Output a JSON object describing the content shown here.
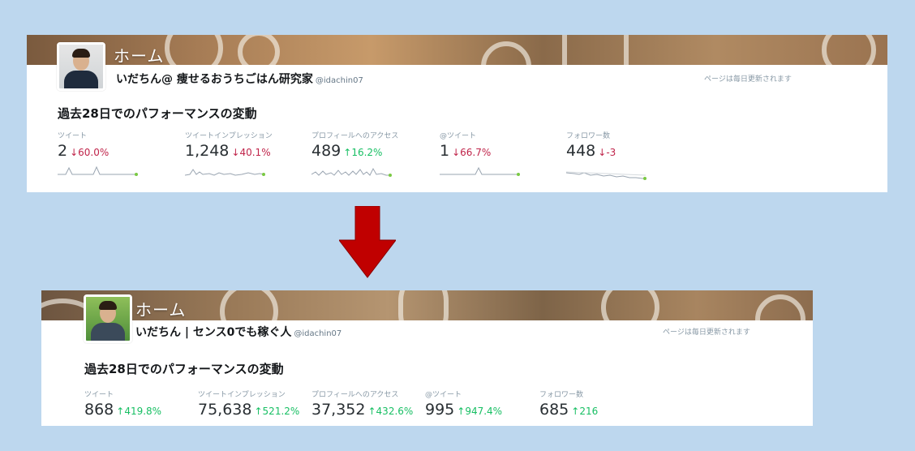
{
  "before": {
    "banner_title": "ホーム",
    "display_name": "いだちん@ 痩せるおうちごはん研究家",
    "handle": "@idachin07",
    "update_note": "ページは毎日更新されます",
    "section_title": "過去28日でのパフォーマンスの変動",
    "metrics": [
      {
        "label": "ツイート",
        "value": "2",
        "arrow": "↓",
        "change": "60.0%",
        "direction": "down"
      },
      {
        "label": "ツイートインプレッション",
        "value": "1,248",
        "arrow": "↓",
        "change": "40.1%",
        "direction": "down"
      },
      {
        "label": "プロフィールへのアクセス",
        "value": "489",
        "arrow": "↑",
        "change": "16.2%",
        "direction": "up"
      },
      {
        "label": "@ツイート",
        "value": "1",
        "arrow": "↓",
        "change": "66.7%",
        "direction": "down"
      },
      {
        "label": "フォロワー数",
        "value": "448",
        "arrow": "↓",
        "change": "-3",
        "direction": "down"
      }
    ]
  },
  "after": {
    "banner_title": "ホーム",
    "display_name": "いだちん | センス0でも稼ぐ人",
    "handle": "@idachin07",
    "update_note": "ページは毎日更新されます",
    "section_title": "過去28日でのパフォーマンスの変動",
    "metrics": [
      {
        "label": "ツイート",
        "value": "868",
        "arrow": "↑",
        "change": "419.8%",
        "direction": "up"
      },
      {
        "label": "ツイートインプレッション",
        "value": "75,638",
        "arrow": "↑",
        "change": "521.2%",
        "direction": "up"
      },
      {
        "label": "プロフィールへのアクセス",
        "value": "37,352",
        "arrow": "↑",
        "change": "432.6%",
        "direction": "up"
      },
      {
        "label": "@ツイート",
        "value": "995",
        "arrow": "↑",
        "change": "947.4%",
        "direction": "up"
      },
      {
        "label": "フォロワー数",
        "value": "685",
        "arrow": "↑",
        "change": "216",
        "direction": "up"
      }
    ]
  },
  "colors": {
    "background": "#bdd7ee",
    "down": "#c0244a",
    "up": "#17bf63",
    "arrow": "#c00000",
    "sparkline": "#9aa5b1",
    "sparkline_dot": "#7ac943"
  },
  "icons": {
    "transition_arrow": "down-arrow-icon"
  }
}
